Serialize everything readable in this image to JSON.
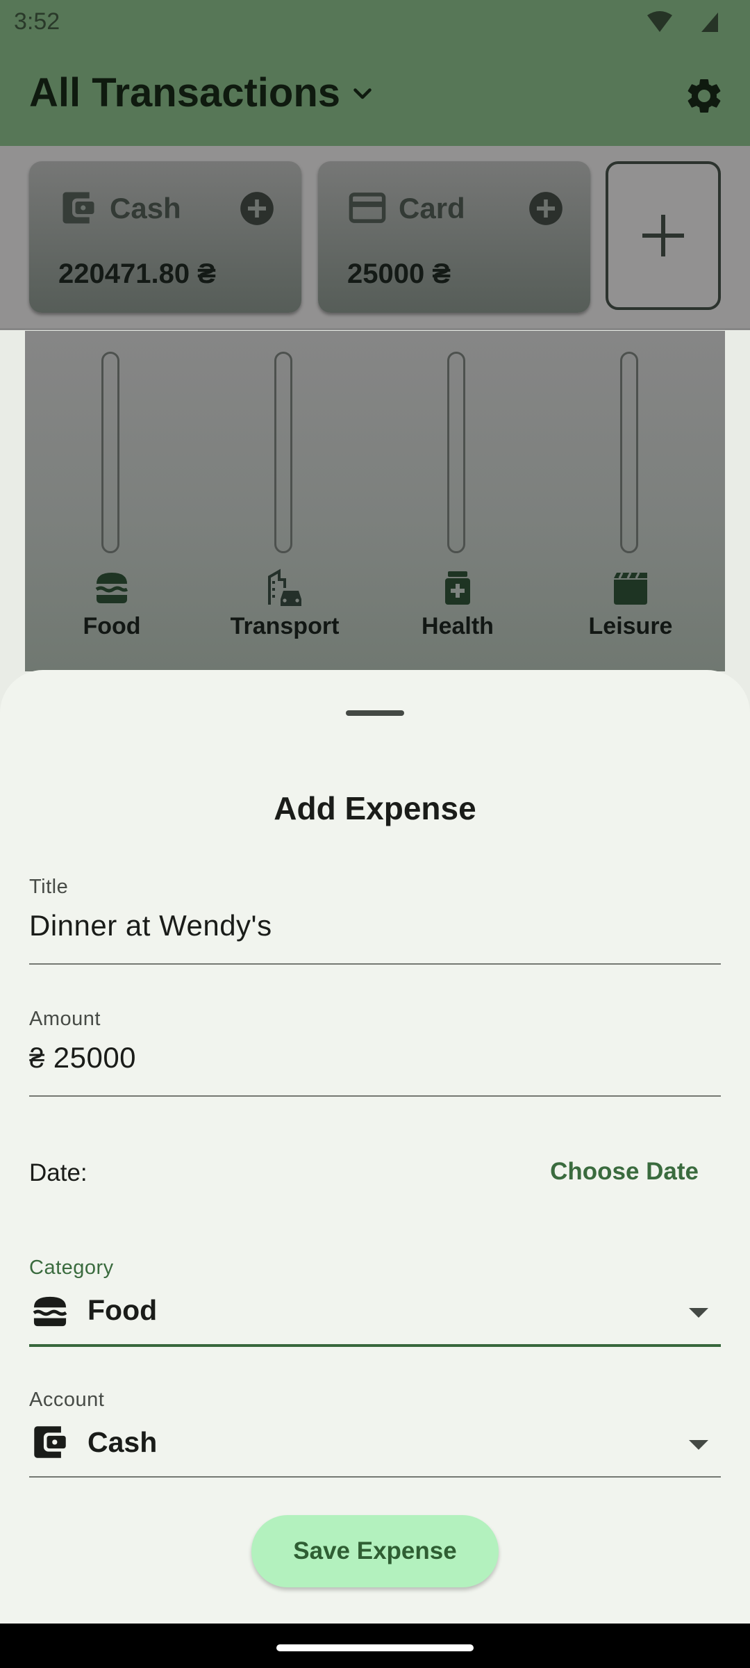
{
  "status_bar": {
    "time": "3:52"
  },
  "app_bar": {
    "title": "All Transactions"
  },
  "accounts": [
    {
      "name": "Cash",
      "balance": "220471.80 ₴",
      "icon": "wallet-icon"
    },
    {
      "name": "Card",
      "balance": "25000 ₴",
      "icon": "credit-card-icon"
    }
  ],
  "categories": [
    {
      "label": "Food",
      "icon": "burger-icon"
    },
    {
      "label": "Transport",
      "icon": "city-car-icon"
    },
    {
      "label": "Health",
      "icon": "medicine-icon"
    },
    {
      "label": "Leisure",
      "icon": "clapperboard-icon"
    }
  ],
  "form": {
    "title": "Add Expense",
    "title_field": {
      "label": "Title",
      "value": "Dinner at Wendy's"
    },
    "amount_field": {
      "label": "Amount",
      "prefix": "₴",
      "value": "25000"
    },
    "date": {
      "label": "Date:",
      "action": "Choose Date"
    },
    "category": {
      "label": "Category",
      "value": "Food",
      "icon": "burger-icon"
    },
    "account": {
      "label": "Account",
      "value": "Cash",
      "icon": "wallet-icon"
    },
    "save_label": "Save Expense"
  },
  "colors": {
    "app_bar": "#577757",
    "accent": "#38673c",
    "save_button": "#b3f1be",
    "sheet_background": "#f1f4ee"
  }
}
